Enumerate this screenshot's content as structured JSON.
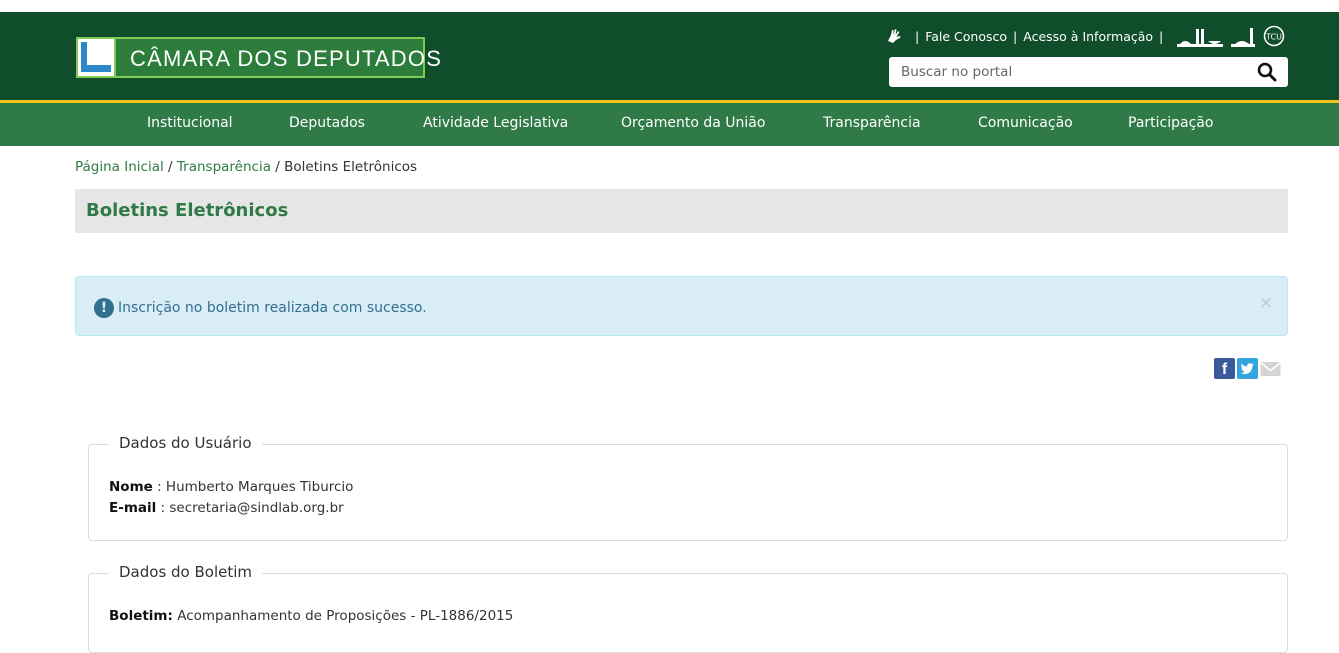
{
  "header": {
    "logo_text": "CÂMARA DOS DEPUTADOS",
    "util_links": [
      "Fale Conosco",
      "Acesso à Informação"
    ],
    "icons": [
      "sign-language-icon",
      "congress-building-icon",
      "congress-tower-icon",
      "tcu-icon"
    ],
    "tcu_label": "TCU",
    "search_placeholder": "Buscar no portal",
    "colors": {
      "header_bg": "#0f4d2b",
      "nav_bg": "#2f7a46",
      "accent_yellow": "#f2c31a",
      "logo_green": "#7fcb53"
    }
  },
  "nav": {
    "items": [
      "Institucional",
      "Deputados",
      "Atividade Legislativa",
      "Orçamento da União",
      "Transparência",
      "Comunicação",
      "Participação"
    ]
  },
  "breadcrumb": {
    "home": "Página Inicial",
    "section": "Transparência",
    "current": "Boletins Eletrônicos",
    "separator": "/"
  },
  "page": {
    "title": "Boletins Eletrônicos"
  },
  "alert": {
    "icon_glyph": "!",
    "message": "Inscrição no boletim realizada com sucesso.",
    "close_glyph": "×"
  },
  "share": {
    "facebook_glyph": "f",
    "icons": [
      "facebook-icon",
      "twitter-icon",
      "email-icon"
    ]
  },
  "user": {
    "legend": "Dados do Usuário",
    "name_label": "Nome",
    "name_value": " : Humberto Marques Tiburcio",
    "email_label": "E-mail",
    "email_value": " : secretaria@sindlab.org.br"
  },
  "bulletin": {
    "legend": "Dados do Boletim",
    "label": "Boletim:",
    "value": " Acompanhamento de Proposições - PL-1886/2015"
  }
}
